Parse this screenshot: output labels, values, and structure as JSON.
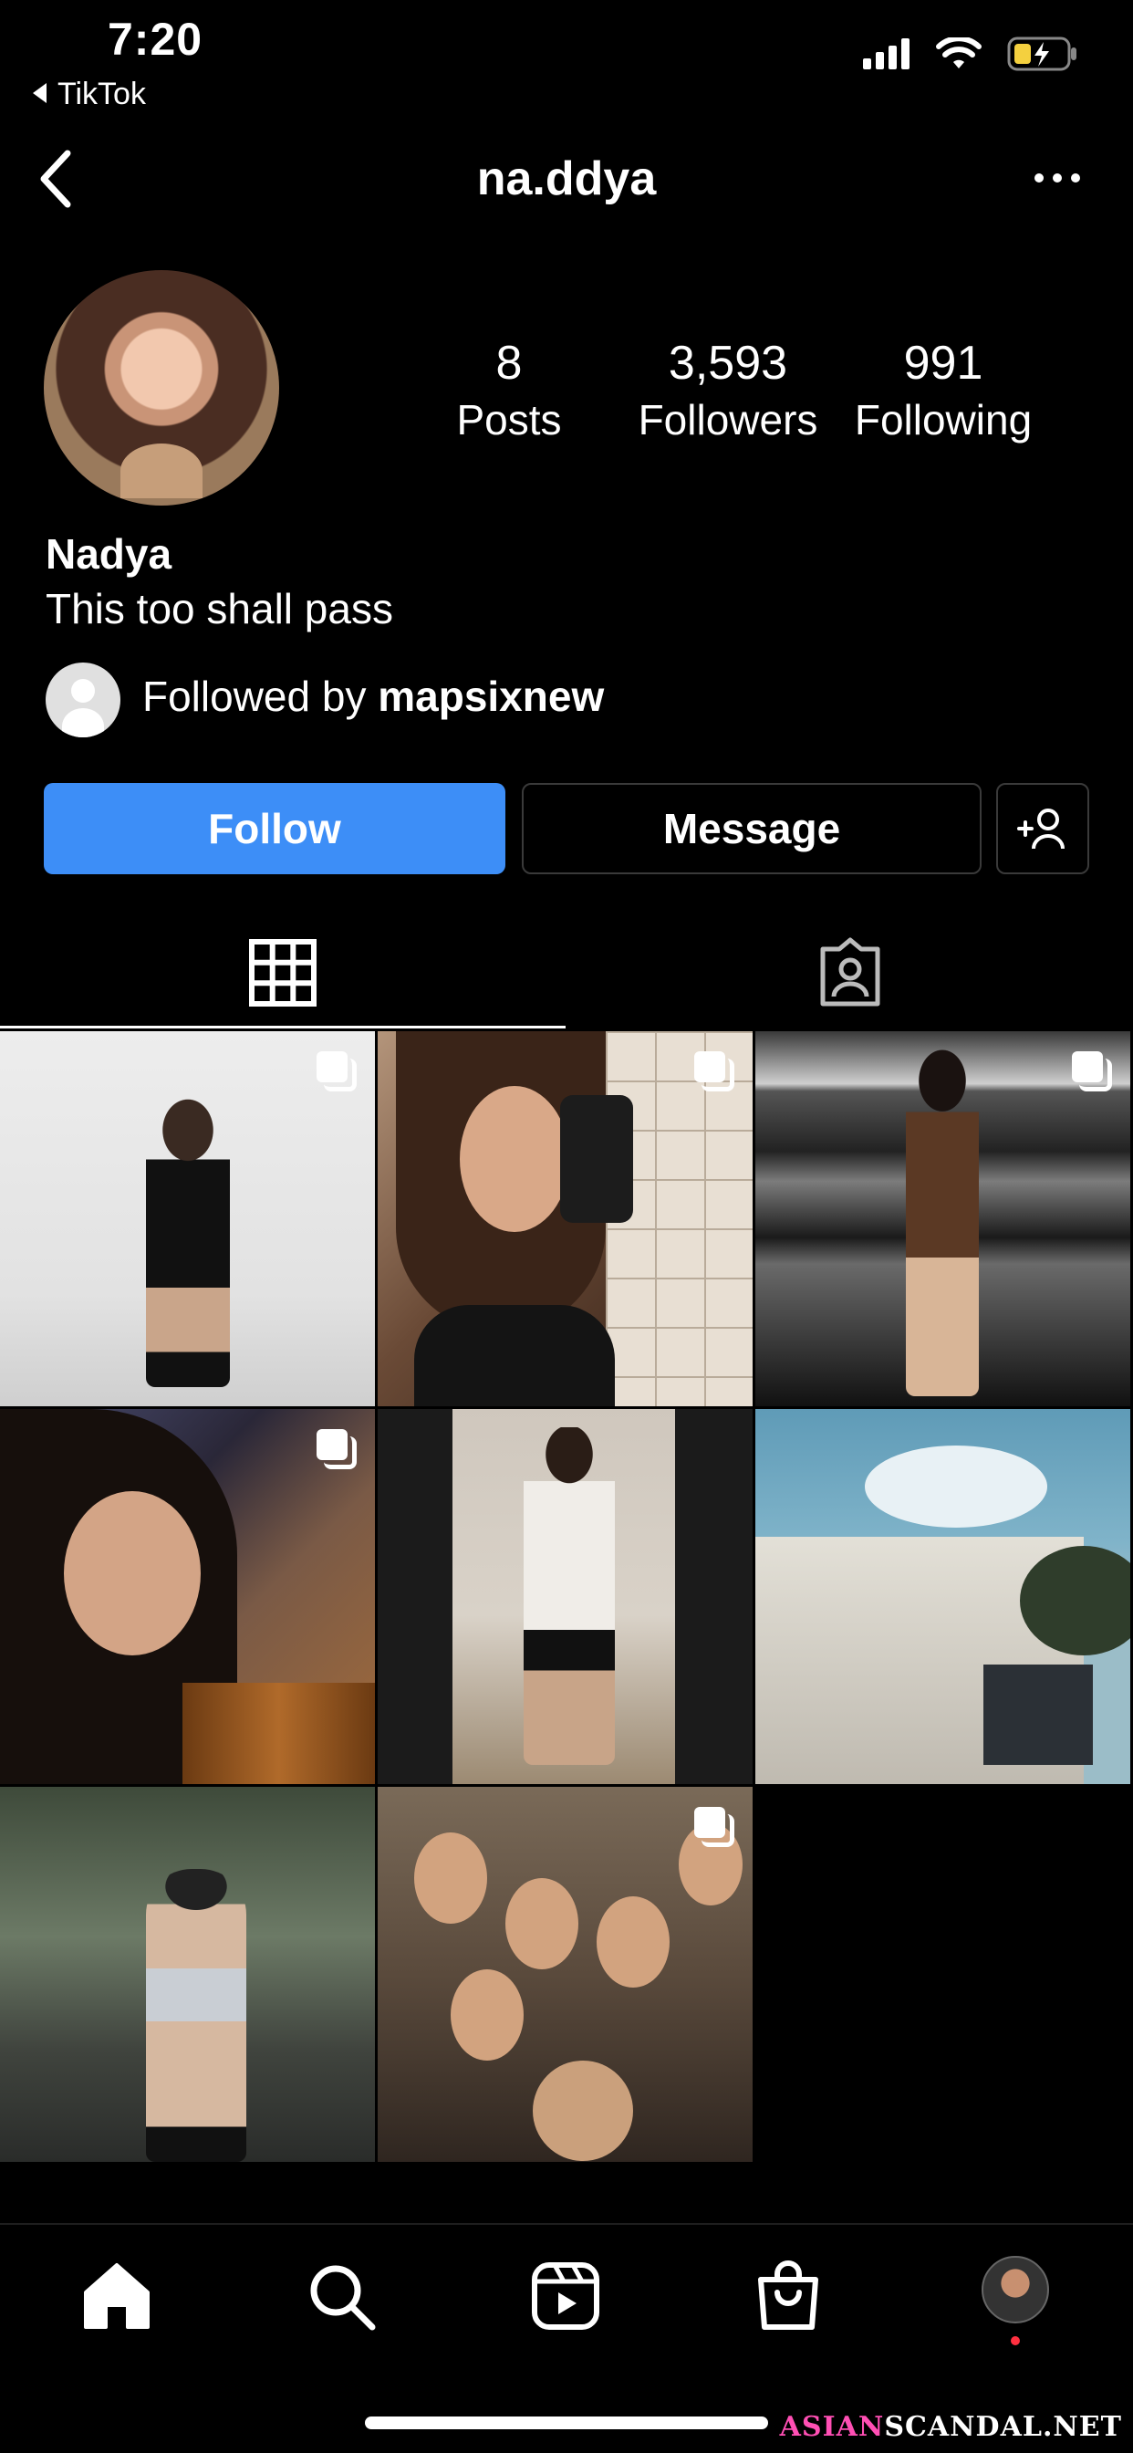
{
  "status_bar": {
    "time": "7:20",
    "back_app": "TikTok"
  },
  "header": {
    "username": "na.ddya"
  },
  "profile": {
    "stats": [
      {
        "value": "8",
        "label": "Posts"
      },
      {
        "value": "3,593",
        "label": "Followers"
      },
      {
        "value": "991",
        "label": "Following"
      }
    ],
    "name": "Nadya",
    "bio": "This too shall pass",
    "followed_by_prefix": "Followed by",
    "followed_by_user": "mapsixnew"
  },
  "actions": {
    "follow": "Follow",
    "message": "Message"
  },
  "tabs": [
    "grid",
    "tagged"
  ],
  "posts": [
    {
      "index": 1,
      "multi": true
    },
    {
      "index": 2,
      "multi": true
    },
    {
      "index": 3,
      "multi": true
    },
    {
      "index": 4,
      "multi": true
    },
    {
      "index": 5,
      "multi": false
    },
    {
      "index": 6,
      "multi": false
    },
    {
      "index": 7,
      "multi": false
    },
    {
      "index": 8,
      "multi": true
    }
  ],
  "bottom_nav": [
    "home-icon",
    "search-icon",
    "reels-icon",
    "shop-icon",
    "profile-avatar"
  ],
  "watermark": {
    "part1": "ASIAN",
    "part2": "SCANDAL.NET"
  },
  "colors": {
    "follow_button": "#3d8ef7",
    "background": "#000000",
    "notification_dot": "#ff3040"
  }
}
